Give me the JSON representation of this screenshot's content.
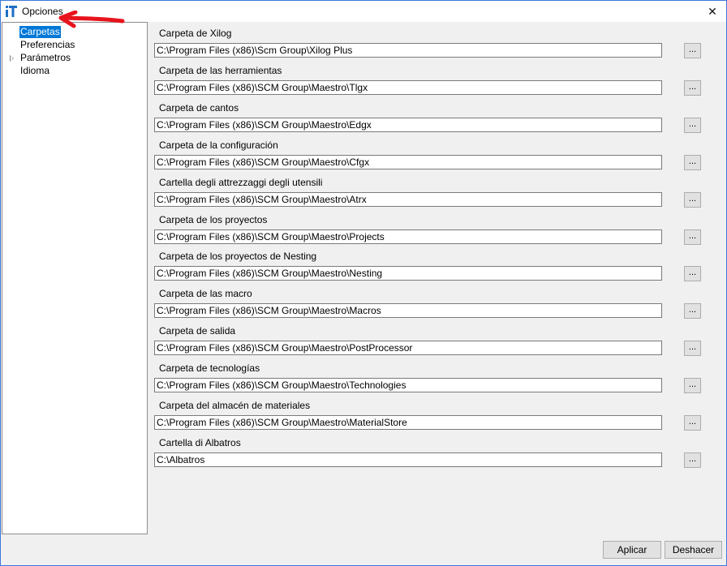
{
  "window": {
    "title": "Opciones",
    "close_glyph": "✕",
    "icon": "app-logo-icon",
    "accent": "#0078d7"
  },
  "tree": {
    "items": [
      {
        "label": "Carpetas",
        "selected": true
      },
      {
        "label": "Preferencias"
      },
      {
        "label": "Parámetros",
        "expandable": true
      },
      {
        "label": "Idioma"
      }
    ]
  },
  "folders": [
    {
      "label": "Carpeta de Xilog",
      "path": "C:\\Program Files (x86)\\Scm Group\\Xilog Plus"
    },
    {
      "label": "Carpeta de las herramientas",
      "path": "C:\\Program Files (x86)\\SCM Group\\Maestro\\Tlgx"
    },
    {
      "label": "Carpeta de cantos",
      "path": "C:\\Program Files (x86)\\SCM Group\\Maestro\\Edgx"
    },
    {
      "label": "Carpeta de la configuración",
      "path": "C:\\Program Files (x86)\\SCM Group\\Maestro\\Cfgx"
    },
    {
      "label": "Cartella degli attrezzaggi degli utensili",
      "path": "C:\\Program Files (x86)\\SCM Group\\Maestro\\Atrx"
    },
    {
      "label": "Carpeta de los proyectos",
      "path": "C:\\Program Files (x86)\\SCM Group\\Maestro\\Projects"
    },
    {
      "label": "Carpeta de los proyectos de Nesting",
      "path": "C:\\Program Files (x86)\\SCM Group\\Maestro\\Nesting"
    },
    {
      "label": "Carpeta de las macro",
      "path": "C:\\Program Files (x86)\\SCM Group\\Maestro\\Macros"
    },
    {
      "label": "Carpeta de salida",
      "path": "C:\\Program Files (x86)\\SCM Group\\Maestro\\PostProcessor"
    },
    {
      "label": "Carpeta de tecnologías",
      "path": "C:\\Program Files (x86)\\SCM Group\\Maestro\\Technologies"
    },
    {
      "label": "Carpeta del almacén de materiales",
      "path": "C:\\Program Files (x86)\\SCM Group\\Maestro\\MaterialStore"
    },
    {
      "label": "Cartella di Albatros",
      "path": "C:\\Albatros"
    }
  ],
  "browse_label": "...",
  "buttons": {
    "apply": "Aplicar",
    "undo": "Deshacer"
  },
  "annotation": {
    "color": "#e8141c",
    "icon": "red-arrow-annotation"
  }
}
